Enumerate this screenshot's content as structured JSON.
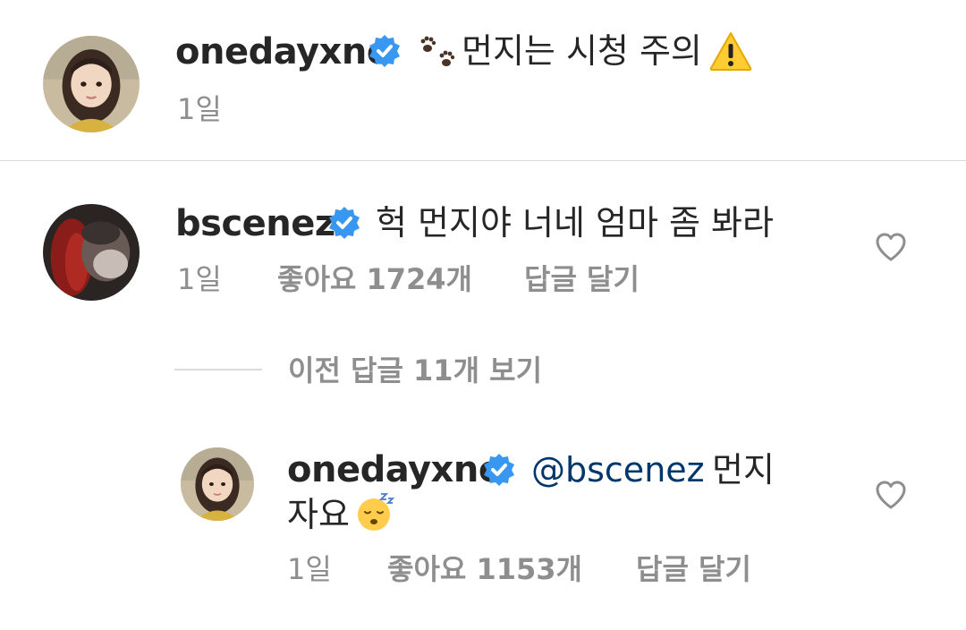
{
  "caption": {
    "username": "onedayxne",
    "text": "먼지는 시청 주의",
    "time": "1일",
    "icons": [
      "verified-badge-icon",
      "paw-prints-icon",
      "warning-icon"
    ]
  },
  "comment": {
    "username": "bscenez",
    "text": "헉 먼지야 너네 엄마 좀 봐라",
    "time": "1일",
    "likes": "좋아요 1724개",
    "reply_label": "답글 달기"
  },
  "view_replies": "이전 답글 11개 보기",
  "reply": {
    "username": "onedayxne",
    "mention": "@bscenez",
    "text_line1": "먼지",
    "text_line2": "자요",
    "time": "1일",
    "likes": "좋아요 1153개",
    "reply_label": "답글 달기",
    "icons": [
      "verified-badge-icon",
      "sleeping-face-icon",
      "heart-outline-icon"
    ]
  },
  "colors": {
    "verified_blue": "#3897f0",
    "mention": "#00376b",
    "meta_gray": "#8e8e8e",
    "divider": "#dbdbdb"
  }
}
